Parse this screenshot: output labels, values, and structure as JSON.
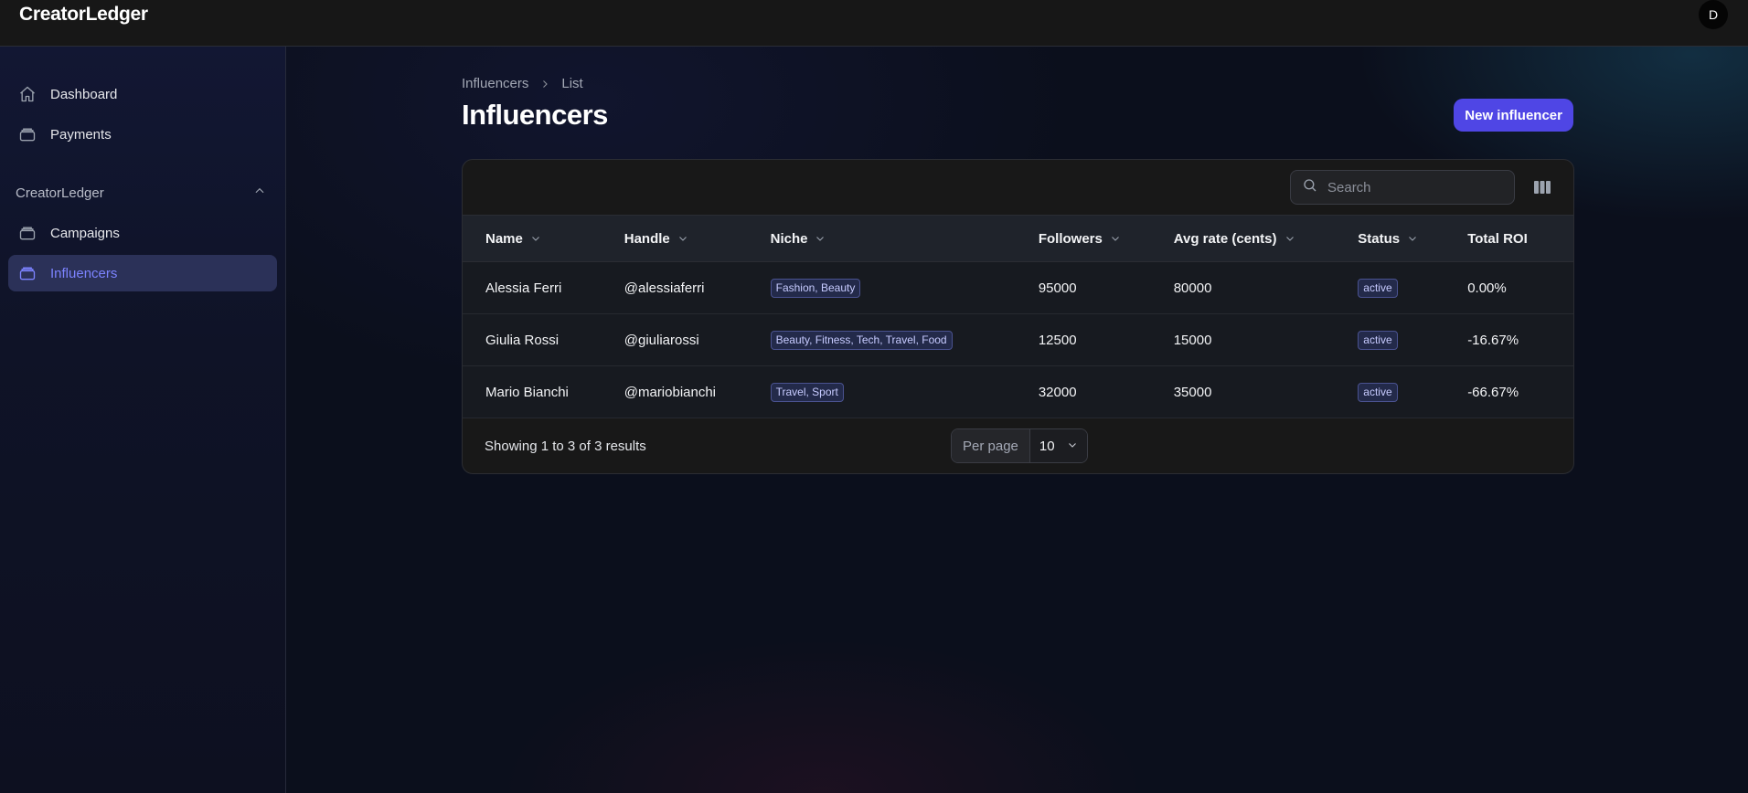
{
  "app": {
    "brand": "CreatorLedger",
    "user_initial": "D"
  },
  "sidebar": {
    "items": [
      {
        "label": "Dashboard",
        "icon": "home-icon"
      },
      {
        "label": "Payments",
        "icon": "stack-icon"
      }
    ],
    "group": {
      "label": "CreatorLedger",
      "items": [
        {
          "label": "Campaigns",
          "icon": "stack-icon"
        },
        {
          "label": "Influencers",
          "icon": "stack-icon",
          "active": true
        }
      ]
    }
  },
  "breadcrumb": [
    "Influencers",
    "List"
  ],
  "page": {
    "title": "Influencers",
    "new_button": "New influencer"
  },
  "search": {
    "placeholder": "Search"
  },
  "table": {
    "columns": [
      "Name",
      "Handle",
      "Niche",
      "Followers",
      "Avg rate (cents)",
      "Status",
      "Total ROI"
    ],
    "rows": [
      {
        "name": "Alessia Ferri",
        "handle": "@alessiaferri",
        "niche": "Fashion, Beauty",
        "followers": "95000",
        "avg_rate": "80000",
        "status": "active",
        "roi": "0.00%"
      },
      {
        "name": "Giulia Rossi",
        "handle": "@giuliarossi",
        "niche": "Beauty, Fitness, Tech, Travel, Food",
        "followers": "12500",
        "avg_rate": "15000",
        "status": "active",
        "roi": "-16.67%"
      },
      {
        "name": "Mario Bianchi",
        "handle": "@mariobianchi",
        "niche": "Travel, Sport",
        "followers": "32000",
        "avg_rate": "35000",
        "status": "active",
        "roi": "-66.67%"
      }
    ]
  },
  "pagination": {
    "summary": "Showing 1 to 3 of 3 results",
    "per_page_label": "Per page",
    "per_page_value": "10"
  },
  "colors": {
    "accent": "#4f46e5",
    "active_nav_text": "#7c83ff",
    "tag_text": "#c7cbff"
  }
}
